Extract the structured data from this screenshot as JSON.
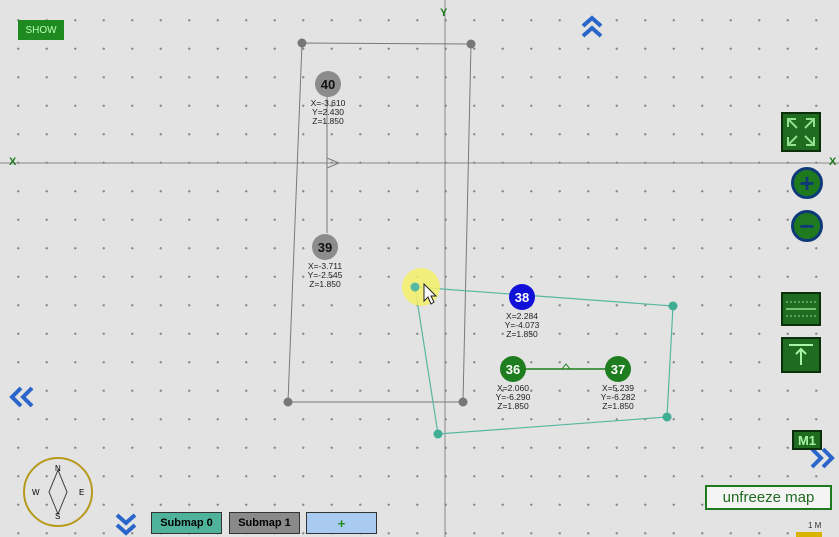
{
  "toolbar": {
    "show_label": "SHOW"
  },
  "axes": {
    "x_label": "X",
    "y_label": "Y"
  },
  "nodes": [
    {
      "id": "40",
      "color": "gray",
      "x": "X=-3.610",
      "y": "Y=2.430",
      "z": "Z=1.850"
    },
    {
      "id": "39",
      "color": "gray",
      "x": "X=-3.711",
      "y": "Y=-2.545",
      "z": "Z=1.850"
    },
    {
      "id": "38",
      "color": "blue",
      "x": "X=2.284",
      "y": "Y=-4.073",
      "z": "Z=1.850"
    },
    {
      "id": "36",
      "color": "green",
      "x": "X=2.060",
      "y": "Y=-6.290",
      "z": "Z=1.850"
    },
    {
      "id": "37",
      "color": "green",
      "x": "X=5.239",
      "y": "Y=-6.282",
      "z": "Z=1.850"
    }
  ],
  "compass": {
    "n": "N",
    "s": "S",
    "e": "E",
    "w": "W"
  },
  "submaps": [
    {
      "label": "Submap 0",
      "color": "#4fb39b"
    },
    {
      "label": "Submap 1",
      "color": "#8a8a8a"
    },
    {
      "label": "+",
      "color": "#a9cbf2"
    }
  ],
  "unfreeze_label": "unfreeze map",
  "m1_label": "M1",
  "scale_label": "1 M",
  "colors": {
    "submap0_path": "#56b8a0",
    "submap1_path": "#7a7a7a",
    "accent": "#1f6b1f",
    "chevron": "#2a66c9"
  }
}
